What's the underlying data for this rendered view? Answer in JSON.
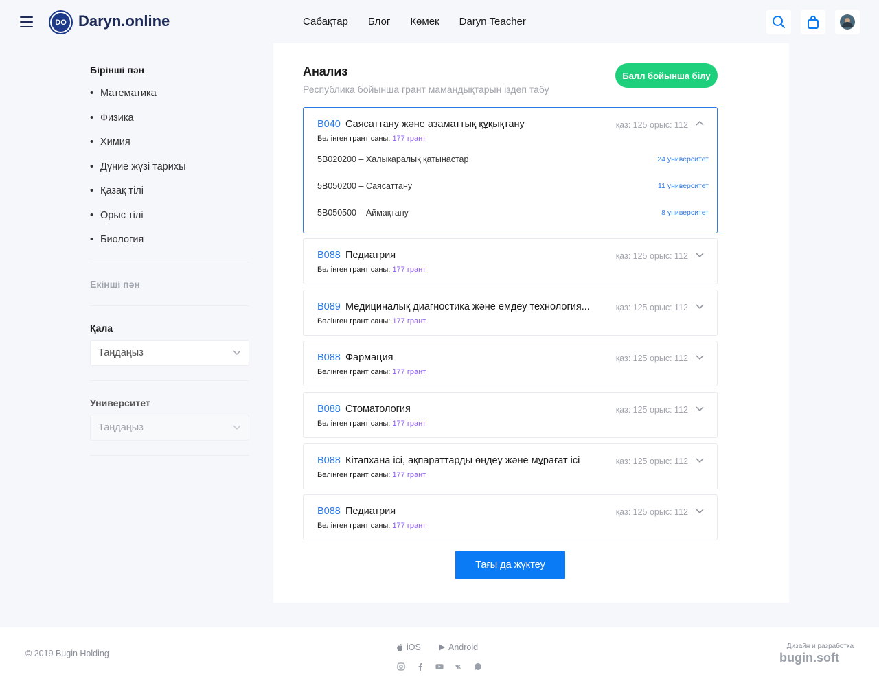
{
  "header": {
    "logo_badge": "DO",
    "logo_text": "Daryn.online",
    "nav": [
      "Сабақтар",
      "Блог",
      "Көмек",
      "Daryn Teacher"
    ]
  },
  "sidebar": {
    "first_subject_title": "Бірінші пән",
    "subjects": [
      "Математика",
      "Физика",
      "Химия",
      "Дүние жүзі тарихы",
      "Қазақ тілі",
      "Орыс тілі",
      "Биология"
    ],
    "second_subject_title": "Екінші пән",
    "city_title": "Қала",
    "city_select": "Таңдаңыз",
    "university_title": "Университет",
    "university_select": "Таңдаңыз"
  },
  "main": {
    "title": "Анализ",
    "subtitle": "Республика бойынша грант мамандықтарын іздеп табу",
    "score_button": "Балл бойынша білу",
    "grant_label": "Бөлінген грант саны:",
    "cards": [
      {
        "code": "B040",
        "name": "Саясаттану және азаматтық құқықтану",
        "grants": "177 грант",
        "counts": "қаз: 125 орыс: 112",
        "open": true,
        "subs": [
          {
            "name": "5B020200 – Халықаралық қатынастар",
            "link": "24 университет"
          },
          {
            "name": "5B050200 – Саясаттану",
            "link": "11 университет"
          },
          {
            "name": "5B050500 – Аймақтану",
            "link": "8 университет"
          }
        ]
      },
      {
        "code": "B088",
        "name": "Педиатрия",
        "grants": "177 грант",
        "counts": "қаз: 125 орыс: 112",
        "open": false
      },
      {
        "code": "B089",
        "name": "Медициналық диагностика және емдеу технология...",
        "grants": "177 грант",
        "counts": "қаз: 125 орыс: 112",
        "open": false
      },
      {
        "code": "B088",
        "name": "Фармация",
        "grants": "177 грант",
        "counts": "қаз: 125 орыс: 112",
        "open": false
      },
      {
        "code": "B088",
        "name": "Стоматология",
        "grants": "177 грант",
        "counts": "қаз: 125 орыс: 112",
        "open": false
      },
      {
        "code": "B088",
        "name": "Кітапхана ісі, ақпараттарды өңдеу және мұрағат ісі",
        "grants": "177 грант",
        "counts": "қаз: 125 орыс: 112",
        "open": false
      },
      {
        "code": "B088",
        "name": "Педиатрия",
        "grants": "177 грант",
        "counts": "қаз: 125 орыс: 112",
        "open": false
      }
    ],
    "load_more": "Тағы да жүктеу"
  },
  "footer": {
    "copyright": "© 2019 Bugin Holding",
    "ios": "iOS",
    "android": "Android",
    "dev_label": "Дизайн и разработка",
    "dev_brand": "bugin.soft",
    "socials": [
      "instagram-icon",
      "facebook-icon",
      "youtube-icon",
      "vk-icon",
      "whatsapp-icon"
    ]
  },
  "colors": {
    "accent": "#2c7be5",
    "green": "#1ed07b",
    "button_blue": "#0a7af5",
    "grant_purple": "#8d5cf0",
    "brand_navy": "#1d2a57"
  }
}
